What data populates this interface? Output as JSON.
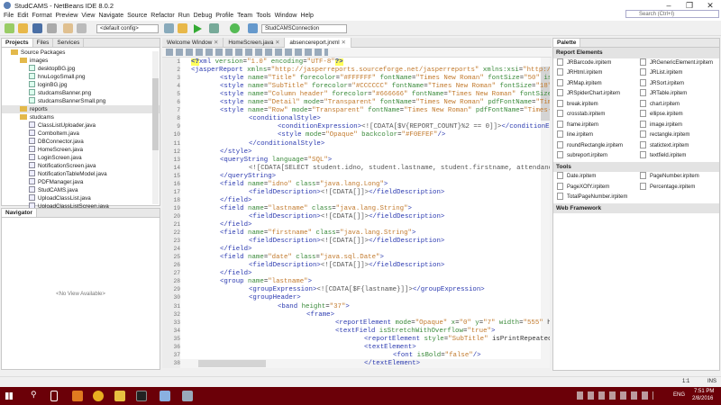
{
  "window": {
    "title": "StudCAMS - NetBeans IDE 8.0.2",
    "minimize": "–",
    "restore": "❐",
    "close": "✕",
    "search_placeholder": "Search (Ctrl+I)"
  },
  "menu": [
    "File",
    "Edit",
    "Format",
    "Preview",
    "View",
    "Navigate",
    "Source",
    "Refactor",
    "Run",
    "Debug",
    "Profile",
    "Team",
    "Tools",
    "Window",
    "Help"
  ],
  "toolbar": {
    "config": "<default config>",
    "connection": "StudCAMSConnection"
  },
  "projects": {
    "tabs": [
      "Projects",
      "Files",
      "Services"
    ],
    "tree": [
      {
        "label": "Source Packages",
        "level": 0,
        "type": "fo"
      },
      {
        "label": "images",
        "level": 1,
        "type": "fo"
      },
      {
        "label": "desktopBG.jpg",
        "level": 2,
        "type": "fi"
      },
      {
        "label": "hnuLogoSmall.png",
        "level": 2,
        "type": "fi"
      },
      {
        "label": "loginBG.jpg",
        "level": 2,
        "type": "fi"
      },
      {
        "label": "studcamsBanner.png",
        "level": 2,
        "type": "fi"
      },
      {
        "label": "studcamsBannerSmall.png",
        "level": 2,
        "type": "fi"
      },
      {
        "label": "reports",
        "level": 1,
        "type": "fo"
      },
      {
        "label": "studcams",
        "level": 1,
        "type": "fo"
      },
      {
        "label": "ClassListUploader.java",
        "level": 2,
        "type": "jv"
      },
      {
        "label": "ComboItem.java",
        "level": 2,
        "type": "jv"
      },
      {
        "label": "DBConnector.java",
        "level": 2,
        "type": "jv"
      },
      {
        "label": "HomeScreen.java",
        "level": 2,
        "type": "jv"
      },
      {
        "label": "LoginScreen.java",
        "level": 2,
        "type": "jv"
      },
      {
        "label": "NotificationScreen.java",
        "level": 2,
        "type": "jv"
      },
      {
        "label": "NotificationTableModel.java",
        "level": 2,
        "type": "jv"
      },
      {
        "label": "PDFManager.java",
        "level": 2,
        "type": "jv"
      },
      {
        "label": "StudCAMS.java",
        "level": 2,
        "type": "jv"
      },
      {
        "label": "UploadClassList.java",
        "level": 2,
        "type": "jv"
      },
      {
        "label": "UploadClassListScreen.java",
        "level": 2,
        "type": "jv"
      }
    ]
  },
  "navigator": {
    "title": "Navigator",
    "empty": "<No View Available>"
  },
  "editor": {
    "tabs": [
      "Welcome Window",
      "HomeScreen.java",
      "absencereport.jrxml"
    ],
    "lines": [
      [
        0,
        "<?xml version=\"1.0\" encoding=\"UTF-8\"?>"
      ],
      [
        0,
        "<jasperReport xmlns=\"http://jasperreports.sourceforge.net/jasperreports\" xmlns:xsi=\"http://www.w"
      ],
      [
        1,
        "<style name=\"Title\" forecolor=\"#FFFFFF\" fontName=\"Times New Roman\" fontSize=\"50\" isBold="
      ],
      [
        1,
        "<style name=\"SubTitle\" forecolor=\"#CCCCCC\" fontName=\"Times New Roman\" fontSize=\"18\" isBo"
      ],
      [
        1,
        "<style name=\"Column header\" forecolor=\"#666666\" fontName=\"Times New Roman\" fontSize=\"14\""
      ],
      [
        1,
        "<style name=\"Detail\" mode=\"Transparent\" fontName=\"Times New Roman\" pdfFontName=\"Times-Ro"
      ],
      [
        1,
        "<style name=\"Row\" mode=\"Transparent\" fontName=\"Times New Roman\" pdfFontName=\"Times-Roman"
      ],
      [
        2,
        "<conditionalStyle>"
      ],
      [
        3,
        "<conditionExpression><![CDATA[$V{REPORT_COUNT}%2 == 0]]></conditionExpre"
      ],
      [
        3,
        "<style mode=\"Opaque\" backcolor=\"#F0EFEF\"/>"
      ],
      [
        2,
        "</conditionalStyle>"
      ],
      [
        1,
        "</style>"
      ],
      [
        1,
        "<queryString language=\"SQL\">"
      ],
      [
        2,
        "<![CDATA[SELECT student.idno, student.lastname, student.firstname, attendance.da"
      ],
      [
        1,
        "</queryString>"
      ],
      [
        1,
        "<field name=\"idno\" class=\"java.lang.Long\">"
      ],
      [
        2,
        "<fieldDescription><![CDATA[]]></fieldDescription>"
      ],
      [
        1,
        "</field>"
      ],
      [
        1,
        "<field name=\"lastname\" class=\"java.lang.String\">"
      ],
      [
        2,
        "<fieldDescription><![CDATA[]]></fieldDescription>"
      ],
      [
        1,
        "</field>"
      ],
      [
        1,
        "<field name=\"firstname\" class=\"java.lang.String\">"
      ],
      [
        2,
        "<fieldDescription><![CDATA[]]></fieldDescription>"
      ],
      [
        1,
        "</field>"
      ],
      [
        1,
        "<field name=\"date\" class=\"java.sql.Date\">"
      ],
      [
        2,
        "<fieldDescription><![CDATA[]]></fieldDescription>"
      ],
      [
        1,
        "</field>"
      ],
      [
        1,
        "<group name=\"lastname\">"
      ],
      [
        2,
        "<groupExpression><![CDATA[$F{lastname}]]></groupExpression>"
      ],
      [
        2,
        "<groupHeader>"
      ],
      [
        3,
        "<band height=\"37\">"
      ],
      [
        4,
        "<frame>"
      ],
      [
        5,
        "<reportElement mode=\"Opaque\" x=\"0\" y=\"7\" width=\"555\" hei"
      ],
      [
        5,
        "<textField isStretchWithOverflow=\"true\">"
      ],
      [
        6,
        "<reportElement style=\"SubTitle\" isPrintRepeatedV"
      ],
      [
        6,
        "<textElement>"
      ],
      [
        7,
        "<font isBold=\"false\"/>"
      ],
      [
        6,
        "</textElement>"
      ]
    ]
  },
  "palette": {
    "title": "Palette",
    "report_elements_title": "Report Elements",
    "report_elements": [
      "JRBarcode.irpitem",
      "JRGenericElement.irpitem",
      "JRHtml.irpitem",
      "JRList.irpitem",
      "JRMap.irpitem",
      "JRSort.irpitem",
      "JRSpiderChart.irpitem",
      "JRTable.irpitem",
      "break.irpitem",
      "chart.irpitem",
      "crosstab.irpitem",
      "ellipse.irpitem",
      "frame.irpitem",
      "image.irpitem",
      "line.irpitem",
      "rectangle.irpitem",
      "roundRectangle.irpitem",
      "statictext.irpitem",
      "subreport.irpitem",
      "textfield.irpitem"
    ],
    "tools_title": "Tools",
    "tools": [
      "Date.irpitem",
      "PageNumber.irpitem",
      "PageXOfY.irpitem",
      "Percentage.irpitem",
      "TotalPageNumber.irpitem"
    ],
    "web_title": "Web Framework"
  },
  "status": {
    "position": "1:1",
    "mode": "INS"
  },
  "taskbar": {
    "lang": "ENG",
    "time": "7:51 PM",
    "date": "2/8/2016"
  }
}
